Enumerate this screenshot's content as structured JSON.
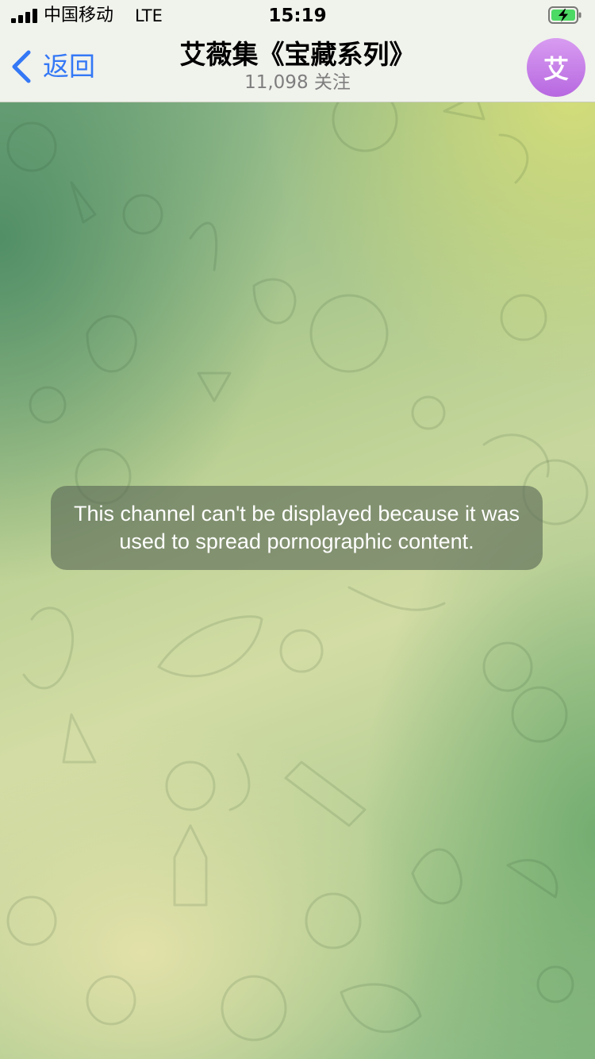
{
  "status_bar": {
    "carrier": "中国移动",
    "network": "LTE",
    "time": "15:19",
    "battery_state": "charging"
  },
  "nav": {
    "back_label": "返回",
    "title": "艾薇集《宝藏系列》",
    "subtitle": "11,098 关注",
    "avatar_letter": "艾"
  },
  "notice": {
    "message": "This channel can't be displayed because it was used to spread pornographic content."
  },
  "colors": {
    "accent": "#3478f6",
    "avatar_gradient_top": "#d89cf1",
    "avatar_gradient_bottom": "#b768e0",
    "battery_green": "#4cd964"
  },
  "icons": {
    "back": "chevron-left-icon",
    "signal": "cellular-signal-icon",
    "battery": "battery-charging-icon"
  }
}
